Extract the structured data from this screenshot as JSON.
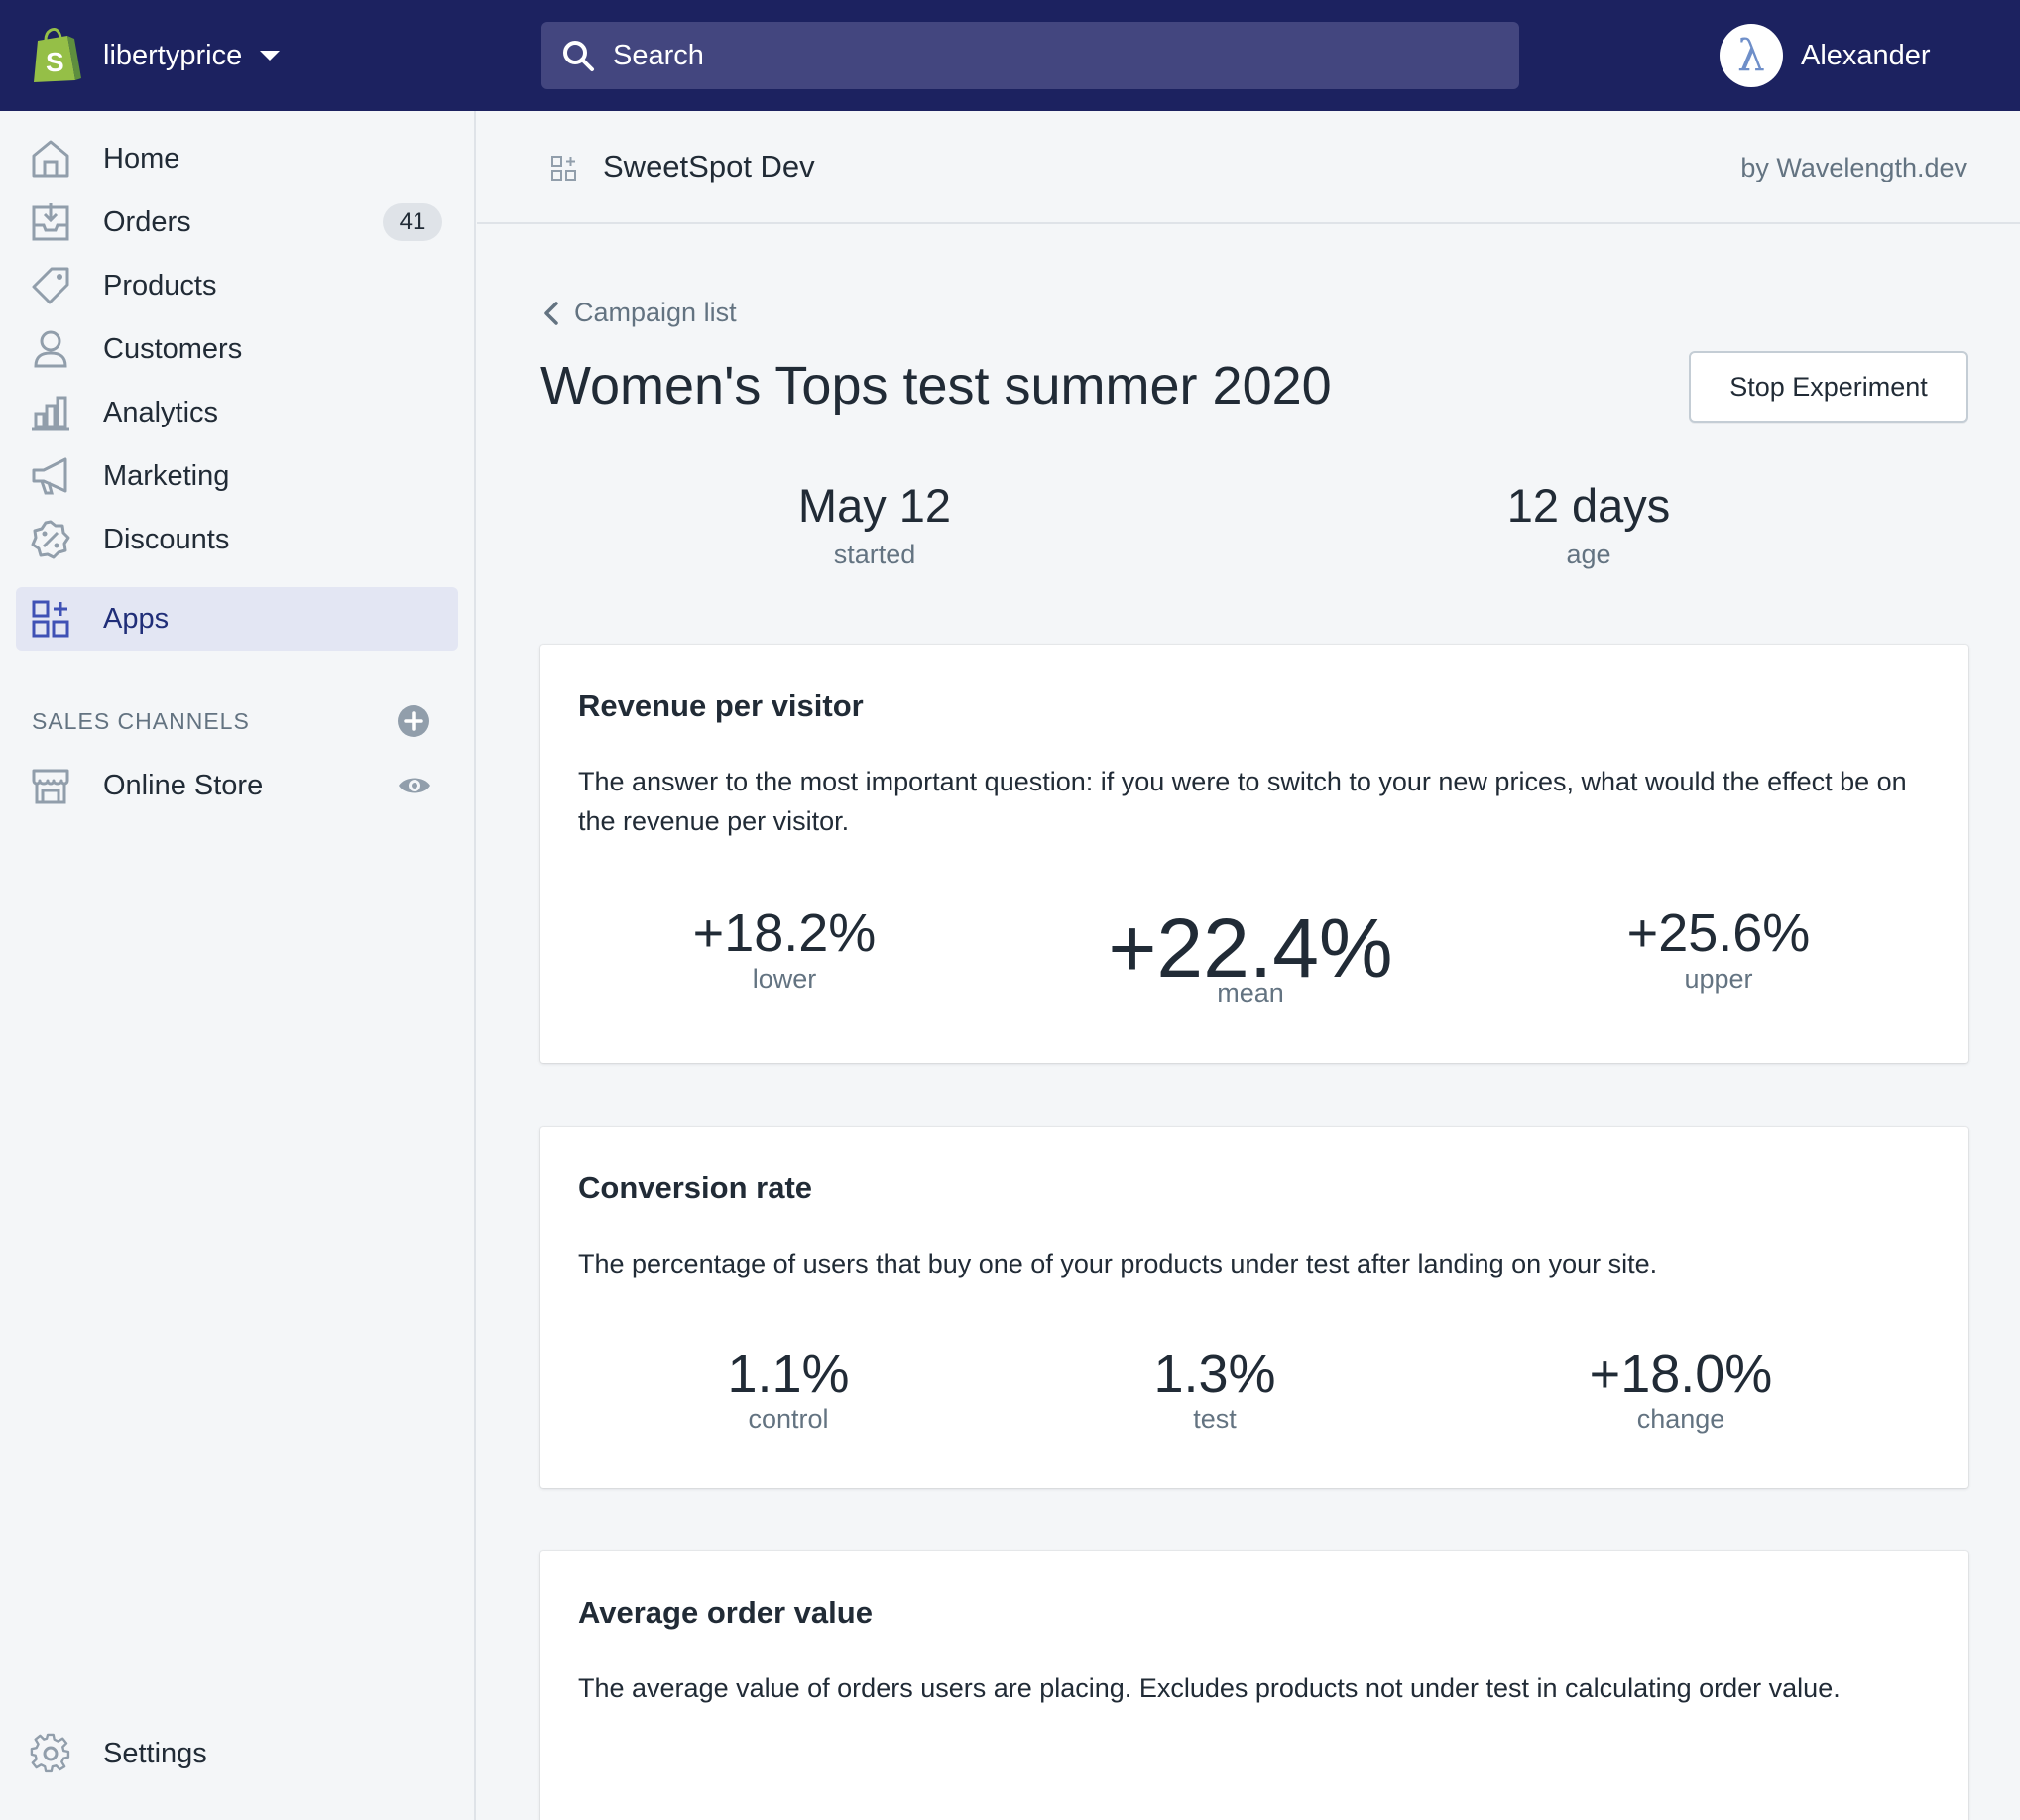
{
  "topbar": {
    "store_name": "libertyprice",
    "search_placeholder": "Search",
    "user_name": "Alexander",
    "avatar_letter": "λ",
    "color": "#1c2260"
  },
  "sidebar": {
    "items": [
      {
        "label": "Home",
        "icon": "home-icon"
      },
      {
        "label": "Orders",
        "icon": "orders-icon",
        "badge": "41"
      },
      {
        "label": "Products",
        "icon": "tag-icon"
      },
      {
        "label": "Customers",
        "icon": "person-icon"
      },
      {
        "label": "Analytics",
        "icon": "bar-chart-icon"
      },
      {
        "label": "Marketing",
        "icon": "megaphone-icon"
      },
      {
        "label": "Discounts",
        "icon": "discount-icon"
      },
      {
        "label": "Apps",
        "icon": "apps-icon",
        "active": true
      }
    ],
    "sales_channels_heading": "SALES CHANNELS",
    "online_store": "Online Store",
    "settings": "Settings"
  },
  "app_header": {
    "title": "SweetSpot Dev",
    "by": "by Wavelength.dev"
  },
  "main": {
    "back_link": "Campaign list",
    "page_title": "Women's Tops test summer 2020",
    "stop_button": "Stop Experiment",
    "started": {
      "value": "May 12",
      "label": "started"
    },
    "age": {
      "value": "12 days",
      "label": "age"
    }
  },
  "cards": {
    "revenue": {
      "title": "Revenue per visitor",
      "description": "The answer to the most important question: if you were to switch to your new prices, what would the effect be on the revenue per visitor.",
      "lower": {
        "value": "+18.2%",
        "label": "lower"
      },
      "mean": {
        "value": "+22.4%",
        "label": "mean"
      },
      "upper": {
        "value": "+25.6%",
        "label": "upper"
      }
    },
    "conversion": {
      "title": "Conversion rate",
      "description": "The percentage of users that buy one of your products under test after landing on your site.",
      "control": {
        "value": "1.1%",
        "label": "control"
      },
      "test": {
        "value": "1.3%",
        "label": "test"
      },
      "change": {
        "value": "+18.0%",
        "label": "change"
      }
    },
    "aov": {
      "title": "Average order value",
      "description": "The average value of orders users are placing. Excludes products not under test in calculating order value."
    }
  }
}
